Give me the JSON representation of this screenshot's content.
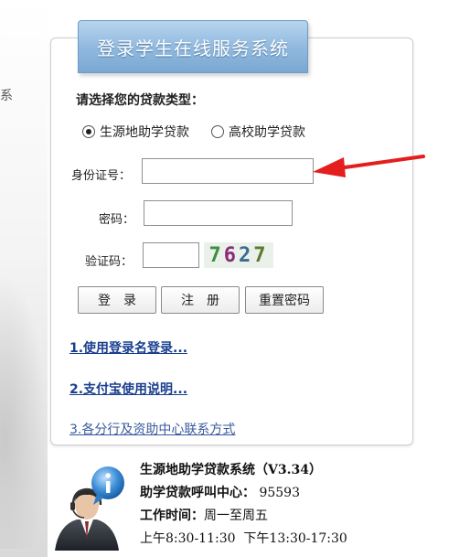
{
  "left_edge_text": "系",
  "title": "登录学生在线服务系统",
  "loan_type_prompt": "请选择您的贷款类型：",
  "loan_types": [
    {
      "label": "生源地助学贷款",
      "selected": true
    },
    {
      "label": "高校助学贷款",
      "selected": false
    }
  ],
  "form": {
    "id_label": "身份证号：",
    "id_value": "",
    "password_label": "密码：",
    "password_value": "",
    "captcha_label": "验证码：",
    "captcha_value": "",
    "captcha_image_text": [
      "7",
      "6",
      "2",
      "7"
    ]
  },
  "buttons": {
    "login": "登　录",
    "register": "注　册",
    "reset": "重置密码"
  },
  "links": [
    "1.使用登录名登录...",
    "2.支付宝使用说明...",
    "3.各分行及资助中心联系方式"
  ],
  "info": {
    "system_name": "生源地助学贷款系统（V3.34）",
    "hotline_label": "助学贷款呼叫中心：",
    "hotline_number": "95593",
    "hours_label": "工作时间：",
    "hours_days": "周一至周五",
    "hours_times": "上午8:30-11:30  下午13:30-17:30"
  },
  "colors": {
    "title_tab": "#8fb8de",
    "link": "#1a3f8f",
    "arrow": "#e41e1e",
    "captcha_digits": [
      "#3c8f3f",
      "#8a2c78",
      "#3c6b8f",
      "#5b7a2a"
    ]
  }
}
